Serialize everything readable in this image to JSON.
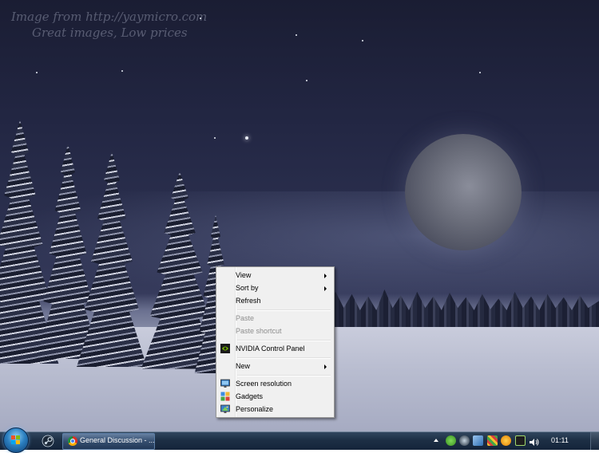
{
  "desktop": {
    "watermark_line1": "Image from http://yaymicro.com",
    "watermark_line2": "Great images, Low prices"
  },
  "context_menu": {
    "items": [
      {
        "label": "View",
        "submenu": true,
        "enabled": true
      },
      {
        "label": "Sort by",
        "submenu": true,
        "enabled": true
      },
      {
        "label": "Refresh",
        "submenu": false,
        "enabled": true
      },
      {
        "label": "Paste",
        "submenu": false,
        "enabled": false
      },
      {
        "label": "Paste shortcut",
        "submenu": false,
        "enabled": false
      },
      {
        "label": "NVIDIA Control Panel",
        "submenu": false,
        "enabled": true,
        "icon": "nvidia-icon"
      },
      {
        "label": "New",
        "submenu": true,
        "enabled": true
      },
      {
        "label": "Screen resolution",
        "submenu": false,
        "enabled": true,
        "icon": "screen-resolution-icon"
      },
      {
        "label": "Gadgets",
        "submenu": false,
        "enabled": true,
        "icon": "gadgets-icon"
      },
      {
        "label": "Personalize",
        "submenu": false,
        "enabled": true,
        "icon": "personalize-icon"
      }
    ]
  },
  "taskbar": {
    "task_button_label": "General Discussion - ...",
    "clock": "01:11",
    "pinned": [
      "steam-icon"
    ],
    "tray_icons": [
      "utorrent-icon",
      "steam-icon",
      "network-icon",
      "app-icon",
      "avast-icon",
      "monitor-icon",
      "volume-icon"
    ]
  },
  "colors": {
    "menu_bg": "#f0f0f0",
    "menu_disabled_text": "#8d8d8d",
    "taskbar": "#1d2f45"
  }
}
